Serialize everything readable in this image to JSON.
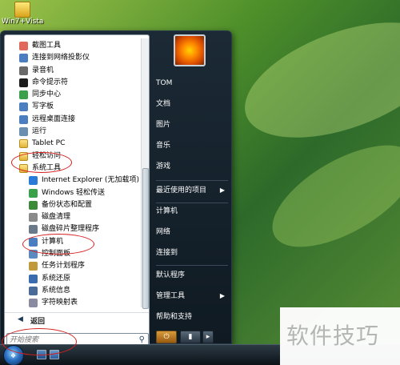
{
  "desktop": {
    "icon_label": "Win7+Vista"
  },
  "programs": [
    {
      "label": "截图工具",
      "level": 0,
      "color": "#e0685a"
    },
    {
      "label": "连接到网络投影仪",
      "level": 0,
      "color": "#4a7ec0"
    },
    {
      "label": "录音机",
      "level": 0,
      "color": "#6a6a6a"
    },
    {
      "label": "命令提示符",
      "level": 0,
      "color": "#1c1c1c"
    },
    {
      "label": "同步中心",
      "level": 0,
      "color": "#3aa04a"
    },
    {
      "label": "写字板",
      "level": 0,
      "color": "#4a7ec0"
    },
    {
      "label": "远程桌面连接",
      "level": 0,
      "color": "#4a7ec0"
    },
    {
      "label": "运行",
      "level": 0,
      "color": "#6a8fb0"
    },
    {
      "label": "Tablet PC",
      "level": 0,
      "color": "folder"
    },
    {
      "label": "轻松访问",
      "level": 0,
      "color": "folder"
    },
    {
      "label": "系统工具",
      "level": 0,
      "color": "folder"
    },
    {
      "label": "Internet Explorer (无加载项)",
      "level": 1,
      "color": "#2a7ad8"
    },
    {
      "label": "Windows 轻松传送",
      "level": 1,
      "color": "#3aa04a"
    },
    {
      "label": "备份状态和配置",
      "level": 1,
      "color": "#3a8a3a"
    },
    {
      "label": "磁盘清理",
      "level": 1,
      "color": "#8a8a8a"
    },
    {
      "label": "磁盘碎片整理程序",
      "level": 1,
      "color": "#6a7a8a"
    },
    {
      "label": "计算机",
      "level": 1,
      "color": "#4a7ec0"
    },
    {
      "label": "控制面板",
      "level": 1,
      "color": "#5a8ac0"
    },
    {
      "label": "任务计划程序",
      "level": 1,
      "color": "#c09a3a"
    },
    {
      "label": "系统还原",
      "level": 1,
      "color": "#3a6ab0"
    },
    {
      "label": "系统信息",
      "level": 1,
      "color": "#4a6a9a"
    },
    {
      "label": "字符映射表",
      "level": 1,
      "color": "#8a8aa0"
    }
  ],
  "left_bottom": {
    "back_label": "返回",
    "search_placeholder": "开始搜索"
  },
  "right_items": {
    "user": "TOM",
    "documents": "文档",
    "pictures": "图片",
    "music": "音乐",
    "games": "游戏",
    "recent": "最近使用的项目",
    "computer": "计算机",
    "network": "网络",
    "connect": "连接到",
    "default_programs": "默认程序",
    "admin_tools": "管理工具",
    "help": "帮助和支持"
  },
  "watermark": "软件技巧",
  "colors": {
    "annotation": "#d42020",
    "menu_dark": "#0f1a22"
  },
  "icons": {
    "search": "search-icon",
    "power": "power-icon",
    "lock": "lock-icon",
    "start": "windows-orb-icon"
  }
}
